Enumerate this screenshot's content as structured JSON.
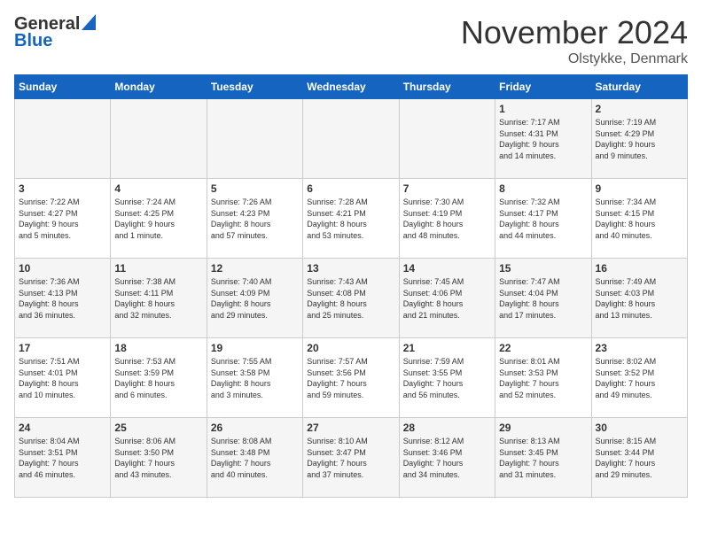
{
  "logo": {
    "general": "General",
    "blue": "Blue"
  },
  "title": {
    "month": "November 2024",
    "location": "Olstykke, Denmark"
  },
  "weekdays": [
    "Sunday",
    "Monday",
    "Tuesday",
    "Wednesday",
    "Thursday",
    "Friday",
    "Saturday"
  ],
  "weeks": [
    [
      {
        "day": "",
        "info": ""
      },
      {
        "day": "",
        "info": ""
      },
      {
        "day": "",
        "info": ""
      },
      {
        "day": "",
        "info": ""
      },
      {
        "day": "",
        "info": ""
      },
      {
        "day": "1",
        "info": "Sunrise: 7:17 AM\nSunset: 4:31 PM\nDaylight: 9 hours\nand 14 minutes."
      },
      {
        "day": "2",
        "info": "Sunrise: 7:19 AM\nSunset: 4:29 PM\nDaylight: 9 hours\nand 9 minutes."
      }
    ],
    [
      {
        "day": "3",
        "info": "Sunrise: 7:22 AM\nSunset: 4:27 PM\nDaylight: 9 hours\nand 5 minutes."
      },
      {
        "day": "4",
        "info": "Sunrise: 7:24 AM\nSunset: 4:25 PM\nDaylight: 9 hours\nand 1 minute."
      },
      {
        "day": "5",
        "info": "Sunrise: 7:26 AM\nSunset: 4:23 PM\nDaylight: 8 hours\nand 57 minutes."
      },
      {
        "day": "6",
        "info": "Sunrise: 7:28 AM\nSunset: 4:21 PM\nDaylight: 8 hours\nand 53 minutes."
      },
      {
        "day": "7",
        "info": "Sunrise: 7:30 AM\nSunset: 4:19 PM\nDaylight: 8 hours\nand 48 minutes."
      },
      {
        "day": "8",
        "info": "Sunrise: 7:32 AM\nSunset: 4:17 PM\nDaylight: 8 hours\nand 44 minutes."
      },
      {
        "day": "9",
        "info": "Sunrise: 7:34 AM\nSunset: 4:15 PM\nDaylight: 8 hours\nand 40 minutes."
      }
    ],
    [
      {
        "day": "10",
        "info": "Sunrise: 7:36 AM\nSunset: 4:13 PM\nDaylight: 8 hours\nand 36 minutes."
      },
      {
        "day": "11",
        "info": "Sunrise: 7:38 AM\nSunset: 4:11 PM\nDaylight: 8 hours\nand 32 minutes."
      },
      {
        "day": "12",
        "info": "Sunrise: 7:40 AM\nSunset: 4:09 PM\nDaylight: 8 hours\nand 29 minutes."
      },
      {
        "day": "13",
        "info": "Sunrise: 7:43 AM\nSunset: 4:08 PM\nDaylight: 8 hours\nand 25 minutes."
      },
      {
        "day": "14",
        "info": "Sunrise: 7:45 AM\nSunset: 4:06 PM\nDaylight: 8 hours\nand 21 minutes."
      },
      {
        "day": "15",
        "info": "Sunrise: 7:47 AM\nSunset: 4:04 PM\nDaylight: 8 hours\nand 17 minutes."
      },
      {
        "day": "16",
        "info": "Sunrise: 7:49 AM\nSunset: 4:03 PM\nDaylight: 8 hours\nand 13 minutes."
      }
    ],
    [
      {
        "day": "17",
        "info": "Sunrise: 7:51 AM\nSunset: 4:01 PM\nDaylight: 8 hours\nand 10 minutes."
      },
      {
        "day": "18",
        "info": "Sunrise: 7:53 AM\nSunset: 3:59 PM\nDaylight: 8 hours\nand 6 minutes."
      },
      {
        "day": "19",
        "info": "Sunrise: 7:55 AM\nSunset: 3:58 PM\nDaylight: 8 hours\nand 3 minutes."
      },
      {
        "day": "20",
        "info": "Sunrise: 7:57 AM\nSunset: 3:56 PM\nDaylight: 7 hours\nand 59 minutes."
      },
      {
        "day": "21",
        "info": "Sunrise: 7:59 AM\nSunset: 3:55 PM\nDaylight: 7 hours\nand 56 minutes."
      },
      {
        "day": "22",
        "info": "Sunrise: 8:01 AM\nSunset: 3:53 PM\nDaylight: 7 hours\nand 52 minutes."
      },
      {
        "day": "23",
        "info": "Sunrise: 8:02 AM\nSunset: 3:52 PM\nDaylight: 7 hours\nand 49 minutes."
      }
    ],
    [
      {
        "day": "24",
        "info": "Sunrise: 8:04 AM\nSunset: 3:51 PM\nDaylight: 7 hours\nand 46 minutes."
      },
      {
        "day": "25",
        "info": "Sunrise: 8:06 AM\nSunset: 3:50 PM\nDaylight: 7 hours\nand 43 minutes."
      },
      {
        "day": "26",
        "info": "Sunrise: 8:08 AM\nSunset: 3:48 PM\nDaylight: 7 hours\nand 40 minutes."
      },
      {
        "day": "27",
        "info": "Sunrise: 8:10 AM\nSunset: 3:47 PM\nDaylight: 7 hours\nand 37 minutes."
      },
      {
        "day": "28",
        "info": "Sunrise: 8:12 AM\nSunset: 3:46 PM\nDaylight: 7 hours\nand 34 minutes."
      },
      {
        "day": "29",
        "info": "Sunrise: 8:13 AM\nSunset: 3:45 PM\nDaylight: 7 hours\nand 31 minutes."
      },
      {
        "day": "30",
        "info": "Sunrise: 8:15 AM\nSunset: 3:44 PM\nDaylight: 7 hours\nand 29 minutes."
      }
    ]
  ]
}
